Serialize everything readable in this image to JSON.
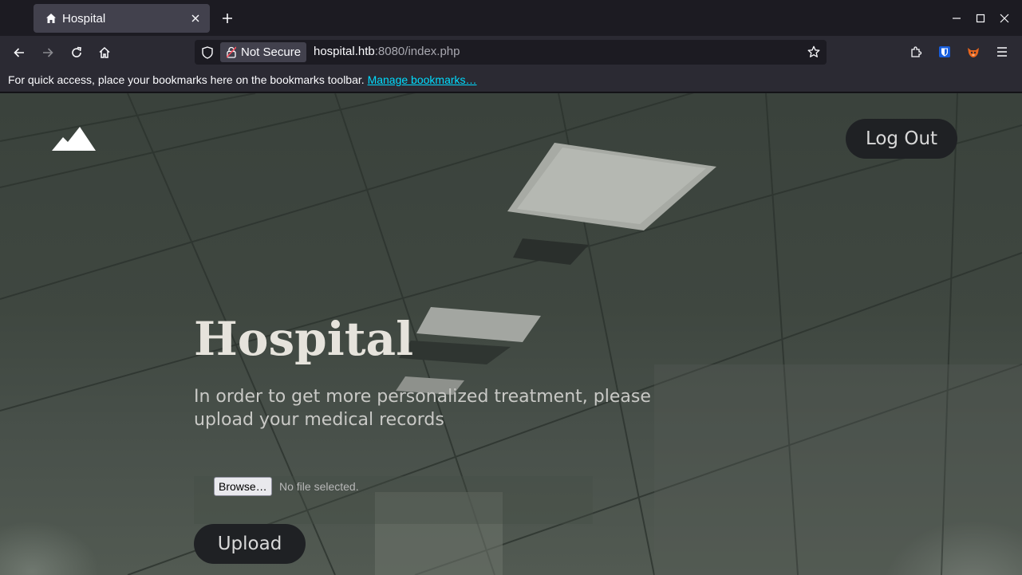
{
  "browser": {
    "tab_title": "Hospital",
    "url_host": "hospital.htb",
    "url_rest": ":8080/index.php",
    "security_label": "Not Secure",
    "bookmarks_message": "For quick access, place your bookmarks here on the bookmarks toolbar.",
    "bookmarks_link": "Manage bookmarks…"
  },
  "page": {
    "title": "Hospital",
    "subtitle": "In order to get more personalized treatment, please upload your medical records",
    "logout_label": "Log Out",
    "browse_label": "Browse…",
    "file_status": "No file selected.",
    "upload_label": "Upload"
  },
  "icons": [
    "home-icon",
    "close-icon",
    "plus-icon",
    "minimize-icon",
    "maximize-icon",
    "back-icon",
    "forward-icon",
    "reload-icon",
    "shield-icon",
    "lock-icon",
    "star-icon",
    "extensions-icon",
    "bitwarden-icon",
    "foxyproxy-icon",
    "menu-icon",
    "mountain-logo-icon"
  ],
  "colors": {
    "chrome_dark": "#1c1b22",
    "chrome_toolbar": "#2b2a33",
    "link": "#00ddff",
    "button_bg": "#1f2124",
    "title_text": "#e6e3dc"
  }
}
